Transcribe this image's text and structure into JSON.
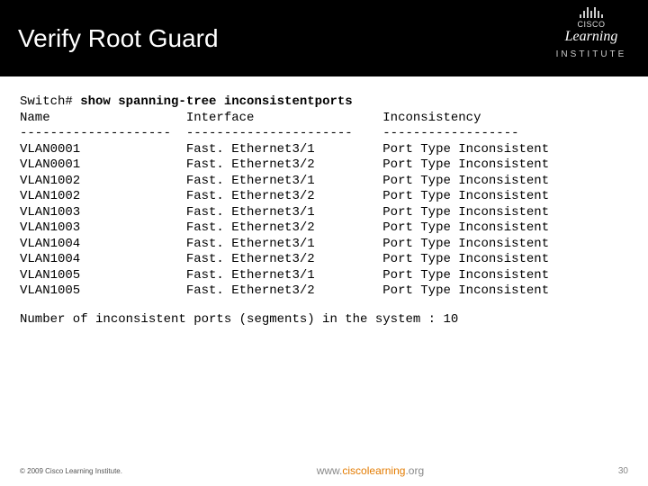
{
  "header": {
    "title": "Verify Root Guard",
    "brand": {
      "top": "CISCO",
      "main": "Learning",
      "sub": "INSTITUTE"
    }
  },
  "terminal": {
    "prompt": "Switch#",
    "command": "show spanning-tree inconsistentports",
    "cols": {
      "name": "Name",
      "iface": "Interface",
      "inc": "Inconsistency"
    },
    "sep": {
      "name": "--------------------",
      "iface": "----------------------",
      "inc": "------------------"
    },
    "rows": [
      {
        "name": "VLAN0001",
        "iface": "Fast. Ethernet3/1",
        "inc": "Port Type Inconsistent"
      },
      {
        "name": "VLAN0001",
        "iface": "Fast. Ethernet3/2",
        "inc": "Port Type Inconsistent"
      },
      {
        "name": "VLAN1002",
        "iface": "Fast. Ethernet3/1",
        "inc": "Port Type Inconsistent"
      },
      {
        "name": "VLAN1002",
        "iface": "Fast. Ethernet3/2",
        "inc": "Port Type Inconsistent"
      },
      {
        "name": "VLAN1003",
        "iface": "Fast. Ethernet3/1",
        "inc": "Port Type Inconsistent"
      },
      {
        "name": "VLAN1003",
        "iface": "Fast. Ethernet3/2",
        "inc": "Port Type Inconsistent"
      },
      {
        "name": "VLAN1004",
        "iface": "Fast. Ethernet3/1",
        "inc": "Port Type Inconsistent"
      },
      {
        "name": "VLAN1004",
        "iface": "Fast. Ethernet3/2",
        "inc": "Port Type Inconsistent"
      },
      {
        "name": "VLAN1005",
        "iface": "Fast. Ethernet3/1",
        "inc": "Port Type Inconsistent"
      },
      {
        "name": "VLAN1005",
        "iface": "Fast. Ethernet3/2",
        "inc": "Port Type Inconsistent"
      }
    ],
    "summary": "Number of inconsistent ports (segments) in the system : 10"
  },
  "footer": {
    "copyright": "© 2009 Cisco Learning Institute.",
    "url_prefix": "www.",
    "url_main": "ciscolearning",
    "url_suffix": ".org",
    "page": "30"
  }
}
